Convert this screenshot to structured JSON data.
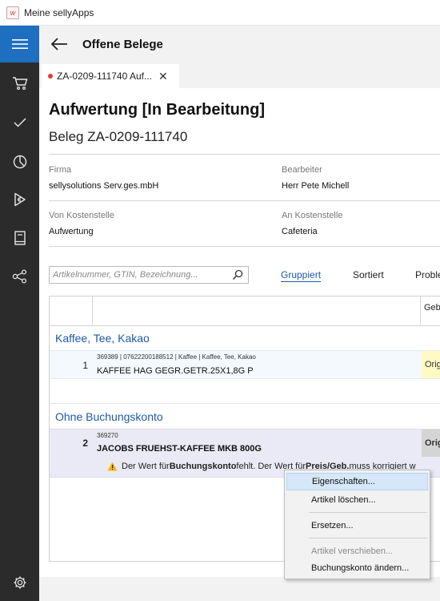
{
  "window": {
    "title": "Meine sellyApps",
    "icon": "w"
  },
  "sidebar": {
    "items": [
      {
        "icon": "hamburger-icon"
      },
      {
        "icon": "cart-icon"
      },
      {
        "icon": "checkmark-icon"
      },
      {
        "icon": "pie-chart-icon"
      },
      {
        "icon": "play-euro-icon"
      },
      {
        "icon": "book-icon"
      },
      {
        "icon": "share-nodes-icon"
      },
      {
        "icon": "gear-icon"
      }
    ],
    "accent": "#1e6fbf",
    "background": "#2b2b2b"
  },
  "header": {
    "title": "Offene Belege",
    "back_icon": "arrow-left-icon"
  },
  "tab": {
    "label": "ZA-0209-111740 Auf...",
    "close": "✕",
    "unsaved_dot_color": "#e53935"
  },
  "document": {
    "title": "Aufwertung [In Bearbeitung]",
    "subtitle": "Beleg ZA-0209-111740",
    "fields": {
      "firma_label": "Firma",
      "firma_value": "sellysolutions Serv.ges.mbH",
      "bearbeiter_label": "Bearbeiter",
      "bearbeiter_value": "Herr Pete Michell",
      "von_label": "Von Kostenstelle",
      "von_value": "Aufwertung",
      "an_label": "An Kostenstelle",
      "an_value": "Cafeteria"
    }
  },
  "search": {
    "placeholder": "Artikelnummer, GTIN, Bezeichnung...",
    "value": ""
  },
  "view_tabs": [
    {
      "label": "Gruppiert",
      "active": true
    },
    {
      "label": "Sortiert",
      "active": false
    },
    {
      "label": "Proble",
      "active": false
    }
  ],
  "grid": {
    "column_header": "Geb",
    "groups": [
      {
        "title": "Kaffee, Tee, Kakao",
        "rows": [
          {
            "num": "1",
            "meta": "369389 | 07622200188512 | Kaffee | Kaffee, Tee, Kakao",
            "name": "KAFFEE HAG GEGR.GETR.25X1,8G P",
            "orig": "Orig",
            "orig_bg": "#fff9c4"
          }
        ]
      },
      {
        "title": "Ohne Buchungskonto",
        "rows": [
          {
            "num": "2",
            "meta": "369270",
            "name": "JACOBS FRUEHST-KAFFEE MKB 800G",
            "orig": "Orig",
            "orig_bg": "#d4d4d4",
            "warning": {
              "t1": "Der Wert für ",
              "b1": "Buchungskonto",
              "t2": " fehlt. Der Wert für ",
              "b2": "Preis/Geb.",
              "t3": " muss korrigiert w"
            }
          }
        ]
      }
    ]
  },
  "context_menu": {
    "items": [
      {
        "label": "Eigenschaften...",
        "highlighted": true,
        "disabled": false
      },
      {
        "label": "Artikel löschen...",
        "highlighted": false,
        "disabled": false
      },
      {
        "label": "Ersetzen...",
        "highlighted": false,
        "disabled": false
      },
      {
        "label": "Artikel verschieben...",
        "highlighted": false,
        "disabled": true
      },
      {
        "label": "Buchungskonto ändern...",
        "highlighted": false,
        "disabled": false
      }
    ]
  }
}
